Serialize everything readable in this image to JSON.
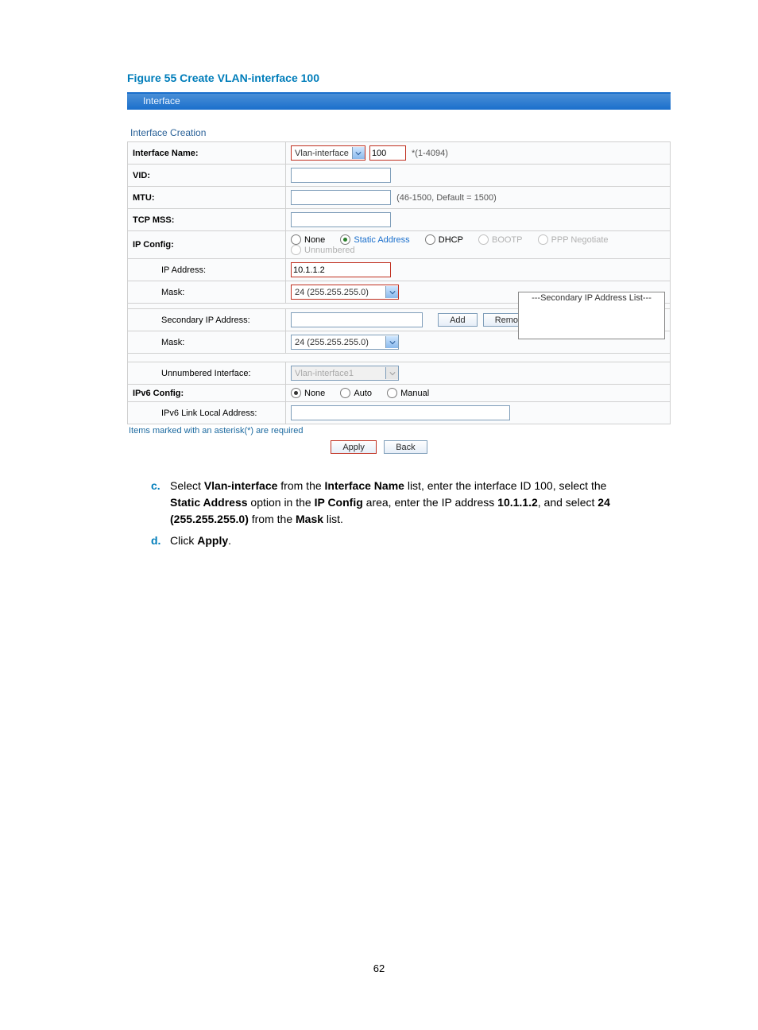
{
  "figure_title": "Figure 55 Create VLAN-interface 100",
  "tab": "Interface",
  "section_title": "Interface Creation",
  "rows": {
    "interface_name": {
      "label": "Interface Name:",
      "select": "Vlan-interface",
      "id_value": "100",
      "hint": "*(1-4094)"
    },
    "vid": {
      "label": "VID:",
      "value": ""
    },
    "mtu": {
      "label": "MTU:",
      "value": "",
      "hint": "(46-1500, Default = 1500)"
    },
    "tcp_mss": {
      "label": "TCP MSS:",
      "value": ""
    },
    "ip_config": {
      "label": "IP Config:",
      "options": {
        "none": "None",
        "static": "Static Address",
        "dhcp": "DHCP",
        "bootp": "BOOTP",
        "ppp": "PPP Negotiate",
        "unnumbered": "Unnumbered"
      }
    },
    "ip_address": {
      "label": "IP Address:",
      "value": "10.1.1.2"
    },
    "mask": {
      "label": "Mask:",
      "select": "24 (255.255.255.0)"
    },
    "secondary_ip": {
      "label": "Secondary IP Address:",
      "value": "",
      "add": "Add",
      "remove": "Remove"
    },
    "secondary_mask": {
      "label": "Mask:",
      "select": "24 (255.255.255.0)"
    },
    "sec_list_header": "---Secondary IP Address List---",
    "unnumbered_if": {
      "label": "Unnumbered Interface:",
      "select": "Vlan-interface1"
    },
    "ipv6_config": {
      "label": "IPv6 Config:",
      "options": {
        "none": "None",
        "auto": "Auto",
        "manual": "Manual"
      }
    },
    "ipv6_link": {
      "label": "IPv6 Link Local Address:",
      "value": ""
    }
  },
  "footnote": "Items marked with an asterisk(*) are required",
  "buttons": {
    "apply": "Apply",
    "back": "Back"
  },
  "instructions": {
    "c_letter": "c.",
    "c_text_parts": {
      "p1": "Select ",
      "b1": "Vlan-interface",
      "p2": " from the ",
      "b2": "Interface Name",
      "p3": " list, enter the interface ID 100, select the ",
      "b3": "Static Address",
      "p4": " option in the ",
      "b4": "IP Config",
      "p5": " area, enter the IP address ",
      "b5": "10.1.1.2",
      "p6": ", and select ",
      "b6": "24 (255.255.255.0)",
      "p7": " from the ",
      "b7": "Mask",
      "p8": " list."
    },
    "d_letter": "d.",
    "d_text_parts": {
      "p1": "Click ",
      "b1": "Apply",
      "p2": "."
    }
  },
  "page_number": "62"
}
